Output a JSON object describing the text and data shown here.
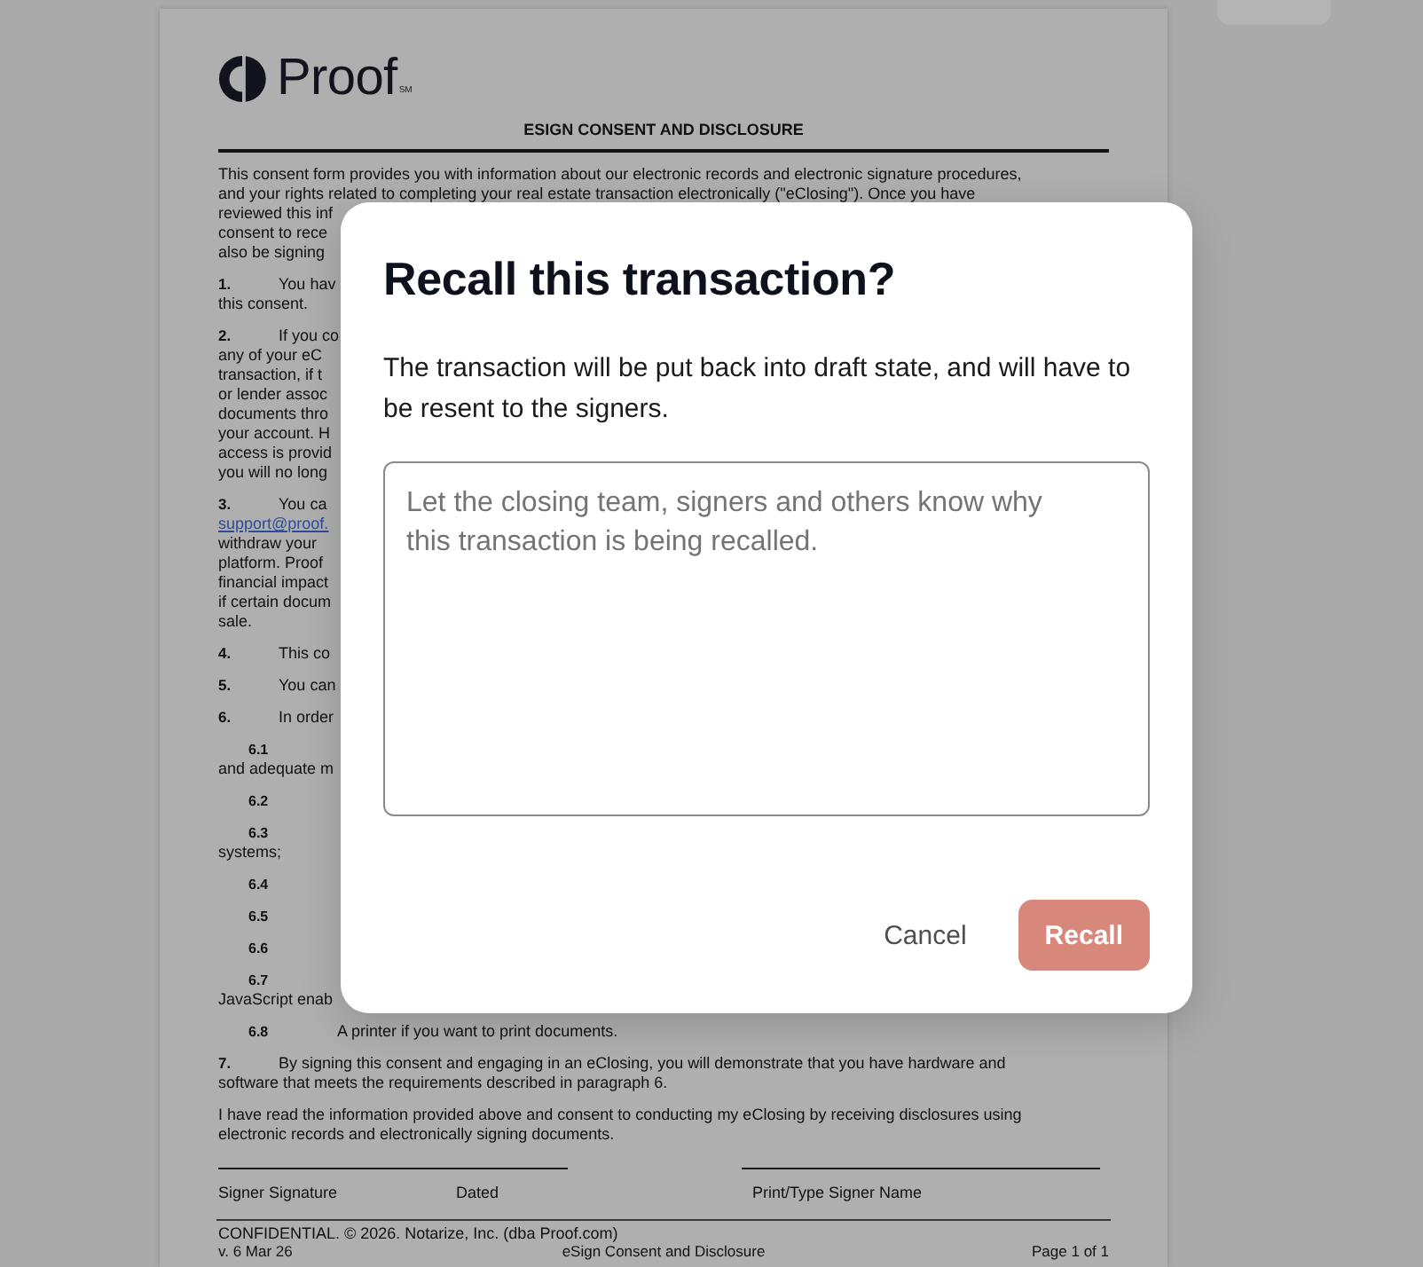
{
  "document": {
    "logo": {
      "text": "Proof",
      "mark": "SM"
    },
    "title": "ESIGN CONSENT AND DISCLOSURE",
    "blocks": [
      {
        "kind": "paragraph",
        "lines": [
          {
            "kind": "text",
            "text": "This consent form provides you with information about our electronic records and electronic signature procedures,"
          },
          {
            "kind": "text",
            "text": "and your rights related to completing your real estate transaction electronically (\"eClosing\"). Once you have"
          },
          {
            "kind": "text",
            "text": "reviewed this inf"
          },
          {
            "kind": "text",
            "text": "consent to rece"
          },
          {
            "kind": "text",
            "text": "also be signing"
          }
        ]
      },
      {
        "kind": "item",
        "number": "1.",
        "first_line": "You hav",
        "lines": [
          {
            "kind": "text",
            "text": "this consent."
          }
        ]
      },
      {
        "kind": "item",
        "number": "2.",
        "first_line": "If you co",
        "lines": [
          {
            "kind": "text",
            "text": "any of your eC"
          },
          {
            "kind": "text",
            "text": "transaction, if t"
          },
          {
            "kind": "text",
            "text": "or lender assoc"
          },
          {
            "kind": "text",
            "text": "documents thro"
          },
          {
            "kind": "text",
            "text": "your account. H"
          },
          {
            "kind": "text",
            "text": "access is provid"
          },
          {
            "kind": "text",
            "text": "you will no long"
          }
        ]
      },
      {
        "kind": "item",
        "number": "3.",
        "first_line": "You ca",
        "lines": [
          {
            "kind": "link",
            "text": "support@proof."
          },
          {
            "kind": "text",
            "text": "withdraw your"
          },
          {
            "kind": "text",
            "text": "platform. Proof"
          },
          {
            "kind": "text",
            "text": "financial impact"
          },
          {
            "kind": "text",
            "text": "if certain docum"
          },
          {
            "kind": "text",
            "text": "sale."
          }
        ]
      },
      {
        "kind": "item",
        "number": "4.",
        "first_line": "This co"
      },
      {
        "kind": "item",
        "number": "5.",
        "first_line": "You can"
      },
      {
        "kind": "item",
        "number": "6.",
        "first_line": "In order"
      },
      {
        "kind": "subitem",
        "number": "6.1",
        "lines": [
          {
            "kind": "text",
            "text": "and adequate m"
          }
        ]
      },
      {
        "kind": "subitem",
        "number": "6.2"
      },
      {
        "kind": "subitem",
        "number": "6.3",
        "lines": [
          {
            "kind": "text",
            "text": "systems;"
          }
        ]
      },
      {
        "kind": "subitem",
        "number": "6.4"
      },
      {
        "kind": "subitem",
        "number": "6.5"
      },
      {
        "kind": "subitem",
        "number": "6.6"
      },
      {
        "kind": "subitem",
        "number": "6.7",
        "lines": [
          {
            "kind": "text",
            "text": "JavaScript enab"
          }
        ]
      },
      {
        "kind": "subitem",
        "number": "6.8",
        "first_line": "A printer if you want to print documents."
      },
      {
        "kind": "item",
        "number": "7.",
        "first_line": "By signing this consent and engaging in an eClosing, you will demonstrate that you have hardware and",
        "lines": [
          {
            "kind": "text",
            "text": "software that meets the requirements described in paragraph 6."
          }
        ]
      },
      {
        "kind": "paragraph",
        "lines": [
          {
            "kind": "text",
            "text": "I have read the information provided above and consent to conducting my eClosing by receiving disclosures using"
          },
          {
            "kind": "text",
            "text": "electronic records and electronically signing documents."
          }
        ]
      }
    ],
    "signature_fields": [
      {
        "labels": [
          "Signer Signature",
          "Dated"
        ]
      },
      {
        "labels": [
          "Print/Type Signer Name"
        ]
      }
    ],
    "confidential": "CONFIDENTIAL. © 2026. Notarize, Inc. (dba Proof.com)",
    "footer": [
      "v. 6 Mar 26",
      "eSign Consent and Disclosure",
      "Page 1 of 1"
    ]
  },
  "dialog": {
    "title": "Recall this transaction?",
    "message": "The transaction will be put back into draft state, and will have to be resent to the signers.",
    "reason_field": {
      "placeholder": "Let the closing team, signers and others know why this transaction is being recalled."
    },
    "buttons": [
      {
        "label": "Cancel",
        "kind": "plain",
        "disabled": false
      },
      {
        "label": "Recall",
        "kind": "filled",
        "disabled": true
      }
    ]
  }
}
